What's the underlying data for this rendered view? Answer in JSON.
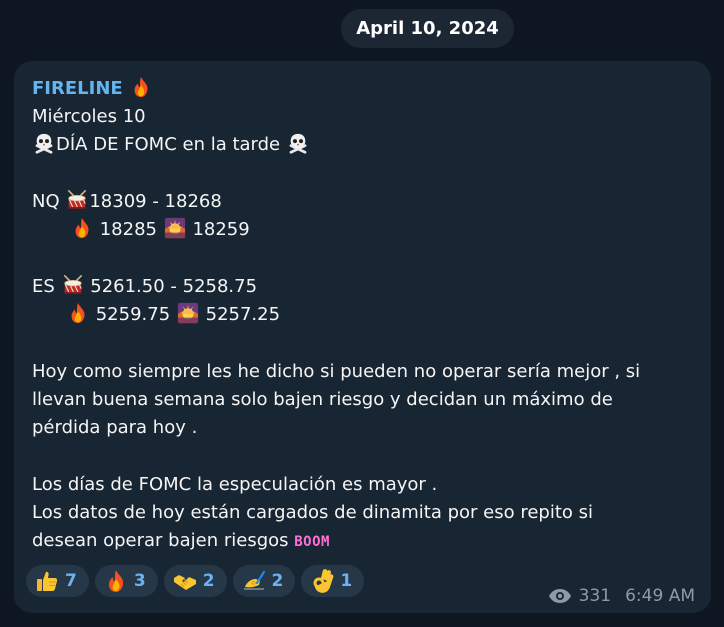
{
  "date_label": "April 10, 2024",
  "message": {
    "sender": "FIRELINE",
    "lines": {
      "l1": "Miércoles 10",
      "l2": "DÍA DE FOMC en la tarde ",
      "nq_label": "NQ ",
      "nq_range": "18309 - 18268",
      "nq_fire": " 18285 ",
      "nq_boom": " 18259",
      "es_label": "ES ",
      "es_range": " 5261.50 - 5258.75",
      "es_fire": " 5259.75 ",
      "es_boom": " 5257.25",
      "p1a": "Hoy como siempre les he dicho si pueden no operar sería mejor , si",
      "p1b": "llevan buena semana solo bajen riesgo y decidan un máximo de",
      "p1c": "pérdida para hoy .",
      "p2a": "Los días de FOMC la especulación es mayor .",
      "p2b": "Los datos de hoy están cargados de dinamita por eso repito si",
      "p2c": "desean operar bajen riesgos ",
      "boom_text": "BOOM"
    }
  },
  "reactions": [
    {
      "icon": "thumbs-up",
      "count": "7"
    },
    {
      "icon": "fire",
      "count": "3"
    },
    {
      "icon": "handshake",
      "count": "2"
    },
    {
      "icon": "writing-hand",
      "count": "2"
    },
    {
      "icon": "ok-hand",
      "count": "1"
    }
  ],
  "views": "331",
  "time": "6:49 AM"
}
